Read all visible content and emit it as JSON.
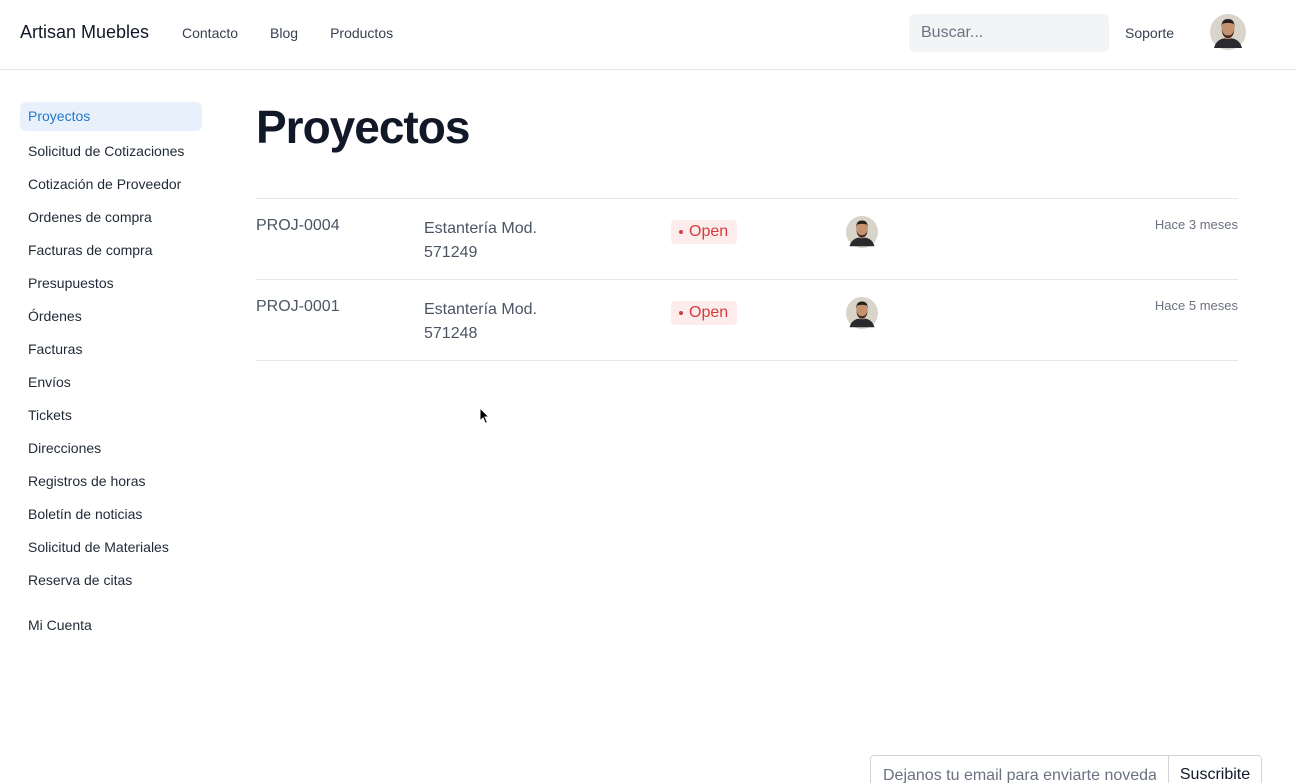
{
  "header": {
    "brand": "Artisan Muebles",
    "nav": [
      "Contacto",
      "Blog",
      "Productos"
    ],
    "search_placeholder": "Buscar...",
    "support": "Soporte"
  },
  "sidebar": {
    "items": [
      {
        "label": "Proyectos",
        "active": true
      },
      {
        "label": "Solicitud de Cotizaciones"
      },
      {
        "label": "Cotización de Proveedor"
      },
      {
        "label": "Ordenes de compra"
      },
      {
        "label": "Facturas de compra"
      },
      {
        "label": "Presupuestos"
      },
      {
        "label": "Órdenes"
      },
      {
        "label": "Facturas"
      },
      {
        "label": "Envíos"
      },
      {
        "label": "Tickets"
      },
      {
        "label": "Direcciones"
      },
      {
        "label": "Registros de horas"
      },
      {
        "label": "Boletín de noticias"
      },
      {
        "label": "Solicitud de Materiales"
      },
      {
        "label": "Reserva de citas"
      }
    ],
    "account": "Mi Cuenta"
  },
  "main": {
    "title": "Proyectos",
    "rows": [
      {
        "id": "PROJ-0004",
        "name": "Estantería Mod. 571249",
        "status": "Open",
        "time": "Hace 3 meses"
      },
      {
        "id": "PROJ-0001",
        "name": "Estantería Mod. 571248",
        "status": "Open",
        "time": "Hace 5 meses"
      }
    ]
  },
  "footer": {
    "newsletter_placeholder": "Dejanos tu email para enviarte novedades",
    "subscribe": "Suscribite"
  },
  "colors": {
    "accent": "#2377c9",
    "active_bg": "#e8f1fb",
    "status_open": "#d33c3c",
    "status_open_bg": "#fdecec"
  }
}
